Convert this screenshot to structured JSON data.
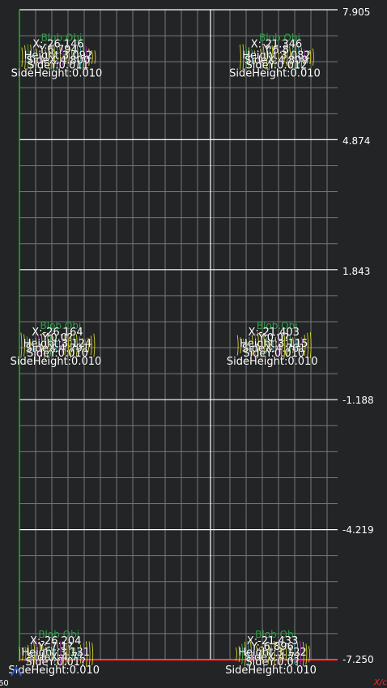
{
  "viewer": {
    "y_axis_labels": [
      "7.905",
      "4.874",
      "1.843",
      "-1.188",
      "-4.219",
      "-7.250"
    ],
    "corner_origin_label": "60",
    "corner_axis_label": "X/c"
  },
  "colors": {
    "background": "#232426",
    "grid_minor": "#777777",
    "grid_major": "#ffffff",
    "y_axis": "#18b418",
    "x_axis": "#ff1a1a",
    "text": "#ffffff",
    "region_label": "#2e9e4a",
    "profile_yellow": "#e6e62a",
    "profile_green": "#3ccc5a",
    "profile_cyan": "#2ab4c8",
    "profile_magenta": "#c22ad6"
  },
  "plot": {
    "y_range": [
      -7.25,
      7.905
    ],
    "x_range": [
      -27.0,
      -20.0
    ]
  },
  "groups": [
    {
      "name": "Blob.Obj",
      "x_val": -26.146,
      "y_val": 6.8,
      "lines": [
        "X:-26.146",
        "Y:6.794",
        "Height:3.092",
        "SideX:4.800",
        "SideY:0.011",
        "SideHeight:0.010"
      ]
    },
    {
      "name": "Blob.Obj",
      "x_val": -21.346,
      "y_val": 6.8,
      "lines": [
        "X:-21.346",
        "Y:6.8",
        "Height:3.082",
        "SideX:4.809",
        "SideY:0.012",
        "SideHeight:0.010"
      ]
    },
    {
      "name": "Blob.Obj",
      "x_val": -26.164,
      "y_val": 0.08,
      "lines": [
        "X:-26.164",
        "Y:0.0?",
        "Height:3.124",
        "SideX:4.791",
        "SideY:0.010",
        "SideHeight:0.010"
      ]
    },
    {
      "name": "Blob.Obj",
      "x_val": -21.403,
      "y_val": 0.08,
      "lines": [
        "X:-21.403",
        "Y:0.0?",
        "Height:3.115",
        "SideX:4.761",
        "SideY:0.010",
        "SideHeight:0.010"
      ]
    },
    {
      "name": "Blob.Obj",
      "x_val": -26.204,
      "y_val": -7.12,
      "lines": [
        "X:-26.204",
        "Y:-7.1?",
        "Height:3.131",
        "SideX:4.7?",
        "SideY:0.01?",
        "SideHeight:0.010"
      ]
    },
    {
      "name": "Blob.Obj",
      "x_val": -21.433,
      "y_val": -7.12,
      "lines": [
        "X:-21.433",
        "Y:-6.896",
        "Height:3.122",
        "SideX:4.7?",
        "SideY:0.0?",
        "SideHeight:0.010"
      ]
    }
  ]
}
